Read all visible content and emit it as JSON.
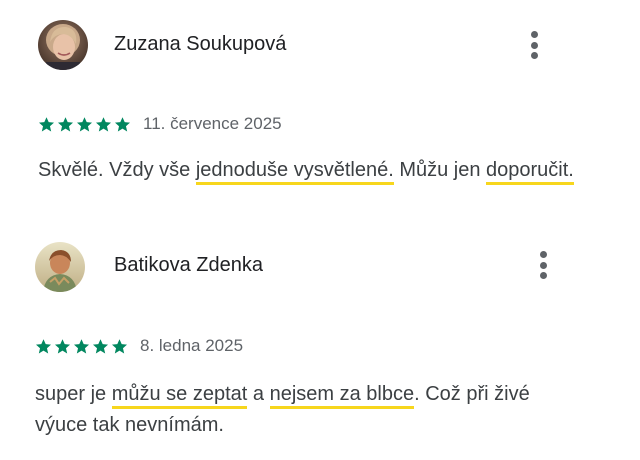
{
  "reviews": [
    {
      "reviewer": "Zuzana Soukupová",
      "rating": 5,
      "date": "11. července 2025",
      "text": [
        {
          "t": "Skvělé. Vždy vše ",
          "hl": false
        },
        {
          "t": "jednoduše vysvětlené.",
          "hl": true
        },
        {
          "t": " Můžu jen ",
          "hl": false
        },
        {
          "t": "doporučit.",
          "hl": true
        }
      ]
    },
    {
      "reviewer": "Batikova Zdenka",
      "rating": 5,
      "date": "8. ledna 2025",
      "text": [
        {
          "t": "super je ",
          "hl": false
        },
        {
          "t": "můžu se zeptat",
          "hl": true
        },
        {
          "t": " a ",
          "hl": false
        },
        {
          "t": "nejsem za blbce",
          "hl": true
        },
        {
          "t": ". Což při živé výuce tak nevnímám.",
          "hl": false
        }
      ]
    }
  ],
  "colors": {
    "star": "#01875f",
    "highlight": "#f7d61d",
    "name": "#202124",
    "date": "#5f6368",
    "body": "#3c4043",
    "menu_dots": "#5f6368"
  },
  "icons": {
    "more": "more-vert-icon",
    "star": "star-icon"
  }
}
